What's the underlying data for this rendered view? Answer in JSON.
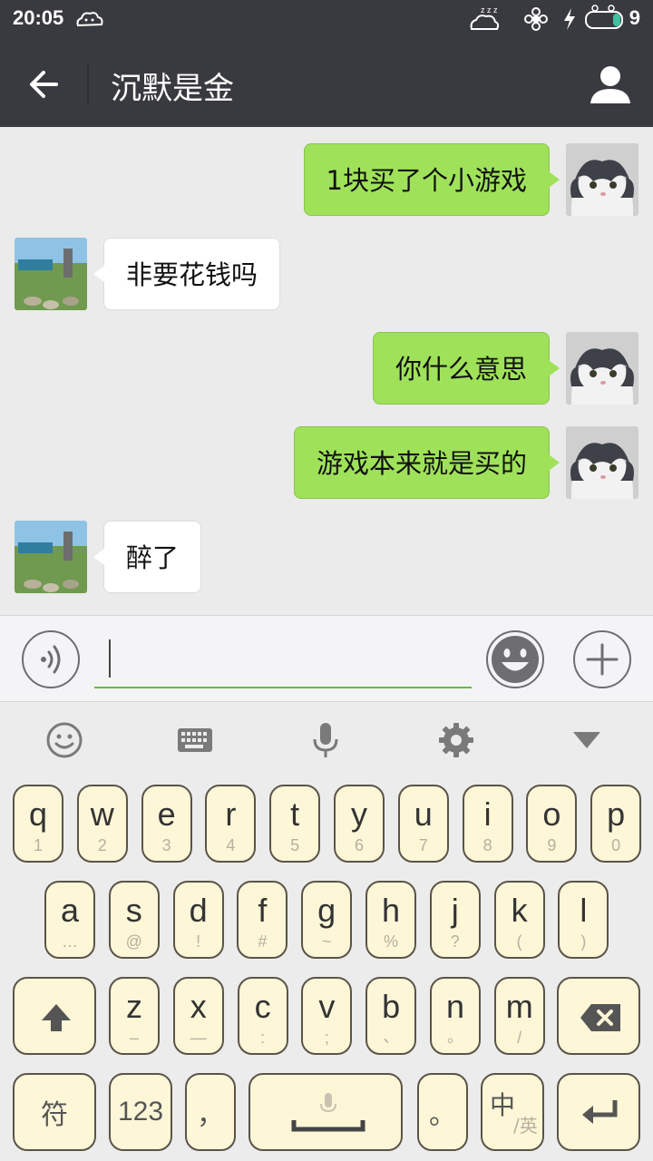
{
  "status_bar": {
    "time": "20:05",
    "battery_level": "9",
    "icons": [
      "weather-icon",
      "sleep-icon",
      "flower-icon",
      "charging-icon",
      "battery-icon"
    ]
  },
  "header": {
    "title": "沉默是金",
    "back_icon": "arrow-left-icon",
    "profile_icon": "person-icon"
  },
  "messages": [
    {
      "side": "sent",
      "text": "1块买了个小游戏"
    },
    {
      "side": "received",
      "text": "非要花钱吗"
    },
    {
      "side": "sent",
      "text": "你什么意思"
    },
    {
      "side": "sent",
      "text": "游戏本来就是买的"
    },
    {
      "side": "received",
      "text": "醉了"
    }
  ],
  "input": {
    "value": "",
    "voice_icon": "voice-icon",
    "emoji_icon": "smiley-icon",
    "plus_icon": "plus-icon"
  },
  "keyboard_toolbar": [
    "emoji-icon",
    "keyboard-icon",
    "microphone-icon",
    "gear-icon",
    "collapse-icon"
  ],
  "keyboard": {
    "row1": [
      {
        "k": "q",
        "s": "1"
      },
      {
        "k": "w",
        "s": "2"
      },
      {
        "k": "e",
        "s": "3"
      },
      {
        "k": "r",
        "s": "4"
      },
      {
        "k": "t",
        "s": "5"
      },
      {
        "k": "y",
        "s": "6"
      },
      {
        "k": "u",
        "s": "7"
      },
      {
        "k": "i",
        "s": "8"
      },
      {
        "k": "o",
        "s": "9"
      },
      {
        "k": "p",
        "s": "0"
      }
    ],
    "row2": [
      {
        "k": "a",
        "s": "…"
      },
      {
        "k": "s",
        "s": "@"
      },
      {
        "k": "d",
        "s": "!"
      },
      {
        "k": "f",
        "s": "#"
      },
      {
        "k": "g",
        "s": "~"
      },
      {
        "k": "h",
        "s": "%"
      },
      {
        "k": "j",
        "s": "?"
      },
      {
        "k": "k",
        "s": "("
      },
      {
        "k": "l",
        "s": ")"
      }
    ],
    "row3": [
      {
        "k": "z",
        "s": "–"
      },
      {
        "k": "x",
        "s": "—"
      },
      {
        "k": "c",
        "s": ":"
      },
      {
        "k": "v",
        "s": ";"
      },
      {
        "k": "b",
        "s": "、"
      },
      {
        "k": "n",
        "s": "。"
      },
      {
        "k": "m",
        "s": "/"
      }
    ],
    "symbols_label": "符",
    "numbers_label": "123",
    "comma_label": "，",
    "period_label": "。",
    "lang_label_main": "中",
    "lang_label_sub": "英"
  }
}
